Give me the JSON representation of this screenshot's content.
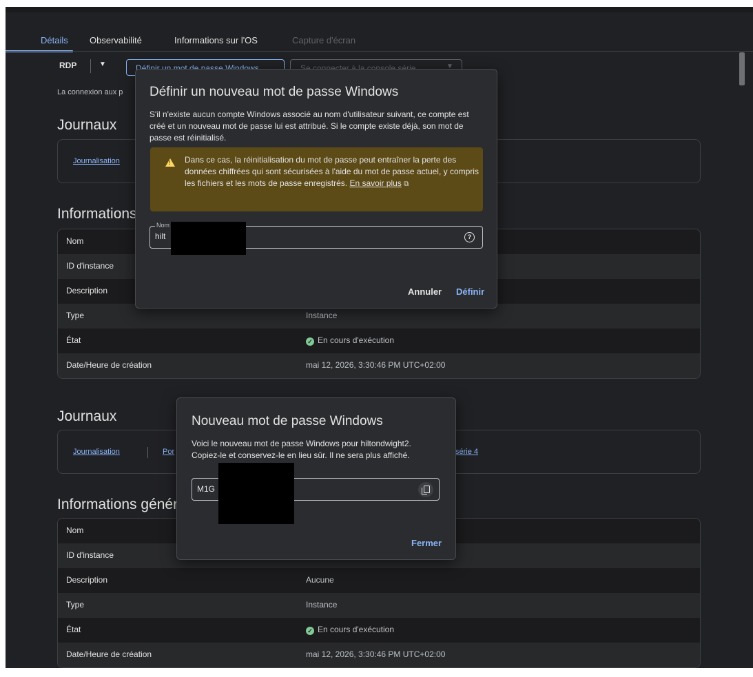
{
  "tabs": [
    {
      "label": "Détails"
    },
    {
      "label": "Observabilité"
    },
    {
      "label": "Informations sur l'OS"
    },
    {
      "label": "Capture d'écran"
    }
  ],
  "toolbar": {
    "rdp_label": "RDP",
    "set_password_label": "Définir un mot de passe Windows",
    "serial_console_label": "Se connecter à la console série",
    "connexion_text": "La connexion aux p"
  },
  "section1": {
    "journaux_title": "Journaux",
    "journaux_links": [
      "Journalisation"
    ],
    "info_title": "Informations",
    "rows": [
      {
        "key": "Nom",
        "value": ""
      },
      {
        "key": "ID d'instance",
        "value": ""
      },
      {
        "key": "Description",
        "value": ""
      },
      {
        "key": "Type",
        "value": "Instance"
      },
      {
        "key": "État",
        "value": "En cours d'exécution"
      },
      {
        "key": "Date/Heure de création",
        "value": "mai 12, 2026, 3:30:46 PM UTC+02:00"
      }
    ]
  },
  "section2": {
    "journaux_title": "Journaux",
    "journaux_links": [
      "Journalisation",
      "Por",
      "série 4"
    ],
    "info_title": "Informations génér",
    "rows": [
      {
        "key": "Nom",
        "value": ""
      },
      {
        "key": "ID d'instance",
        "value": ""
      },
      {
        "key": "Description",
        "value": "Aucune"
      },
      {
        "key": "Type",
        "value": "Instance"
      },
      {
        "key": "État",
        "value": "En cours d'exécution"
      },
      {
        "key": "Date/Heure de création",
        "value": "mai 12, 2026, 3:30:46 PM UTC+02:00"
      }
    ]
  },
  "dialog_set": {
    "title": "Définir un nouveau mot de passe Windows",
    "body": "S'il n'existe aucun compte Windows associé au nom d'utilisateur suivant, ce compte est créé et un nouveau mot de passe lui est attribué. Si le compte existe déjà, son mot de passe est réinitialisé.",
    "warning": "Dans ce cas, la réinitialisation du mot de passe peut entraîner la perte des données chiffrées qui sont sécurisées à l'aide du mot de passe actuel, y compris les fichiers et les mots de passe enregistrés.",
    "warning_link": "En savoir plus",
    "field_label": "Nom",
    "field_value": "hilt",
    "cancel_label": "Annuler",
    "confirm_label": "Définir"
  },
  "dialog_new": {
    "title": "Nouveau mot de passe Windows",
    "body_line1": "Voici le nouveau mot de passe Windows pour hiltondwight2.",
    "body_line2": "Copiez-le et conservez-le en lieu sûr. Il ne sera plus affiché.",
    "password_value": "M1G",
    "close_label": "Fermer"
  },
  "colors": {
    "background": "#202124",
    "accent": "#8ab4f8",
    "warning_bg": "#5c4a17",
    "success": "#81c995"
  }
}
